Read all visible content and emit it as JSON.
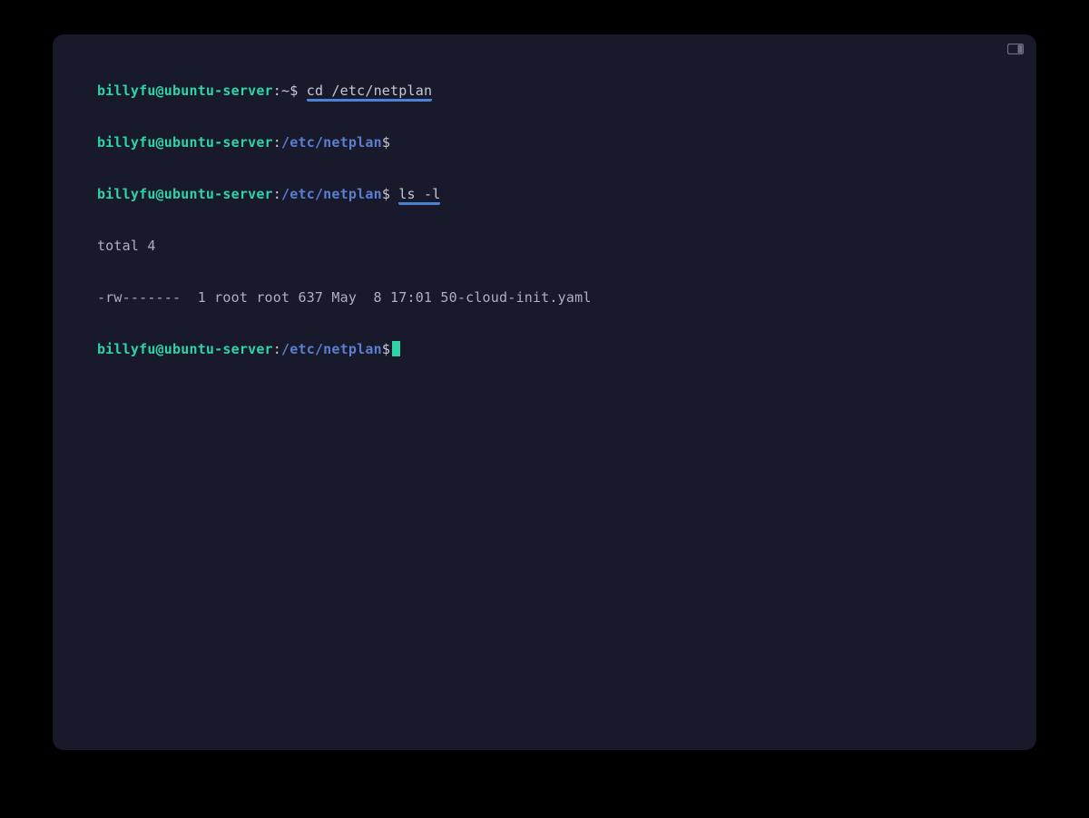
{
  "userhost": "billyfu@ubuntu-server",
  "colon": ":",
  "home_tilde": "~",
  "prompt": "$",
  "dir_path": "/etc/netplan",
  "cmd1": "cd /etc/netplan",
  "cmd2": "ls -l",
  "out_total": "total 4",
  "out_listing": "-rw-------  1 root root 637 May  8 17:01 50-cloud-init.yaml",
  "space": " ",
  "colors": {
    "bg": "#000000",
    "terminal_bg": "#18192a",
    "user_host": "#2fd3a8",
    "path": "#5b7ed0",
    "text": "#c8c9d4",
    "underline": "#4a82d6"
  }
}
